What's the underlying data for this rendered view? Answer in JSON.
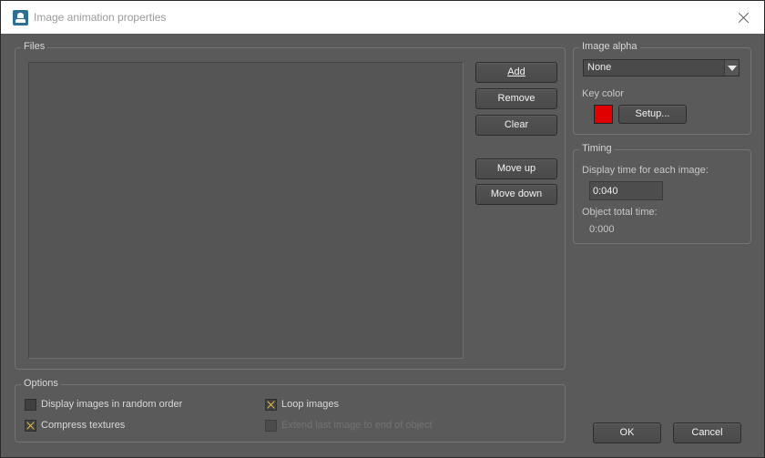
{
  "window": {
    "title": "Image animation properties"
  },
  "files": {
    "group_label": "Files",
    "items": [],
    "buttons": {
      "add": "Add",
      "remove": "Remove",
      "clear": "Clear",
      "move_up": "Move up",
      "move_down": "Move down"
    }
  },
  "options": {
    "group_label": "Options",
    "random_order": {
      "label": "Display images in random order",
      "checked": false
    },
    "compress_textures": {
      "label": "Compress textures",
      "checked": true
    },
    "loop_images": {
      "label": "Loop images",
      "checked": true
    },
    "extend_last": {
      "label": "Extend last image to end of object",
      "checked": false,
      "enabled": false
    }
  },
  "image_alpha": {
    "group_label": "Image alpha",
    "selected": "None",
    "key_color_label": "Key color",
    "key_color": "#e00000",
    "setup_button": "Setup..."
  },
  "timing": {
    "group_label": "Timing",
    "display_time_label": "Display time for each image:",
    "display_time_value": "0:040",
    "total_time_label": "Object total time:",
    "total_time_value": "0:000"
  },
  "footer": {
    "ok": "OK",
    "cancel": "Cancel"
  }
}
